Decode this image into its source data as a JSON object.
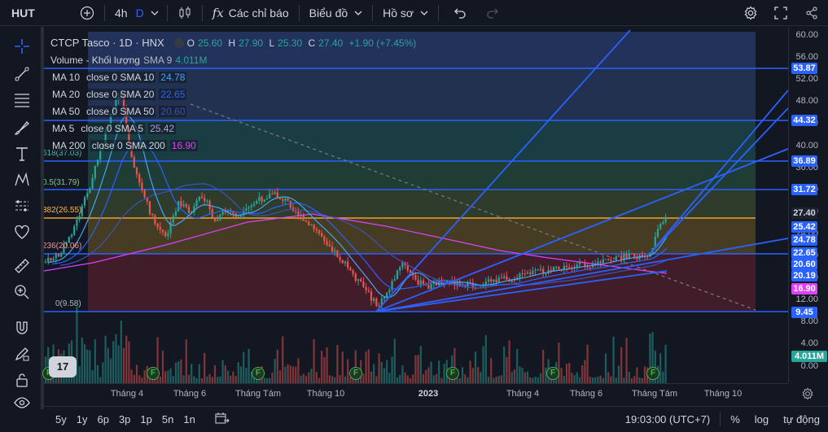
{
  "toolbar": {
    "symbol": "HUT",
    "interval": "4h",
    "interval_alt": "D",
    "indicators_label": "Các chỉ báo",
    "chart_label": "Biểu đồ",
    "profile_label": "Hồ sơ"
  },
  "legend": {
    "title": "CTCP Tasco · 1D · HNX",
    "ohlc": {
      "o_label": "O",
      "o": "25.60",
      "h_label": "H",
      "h": "27.90",
      "l_label": "L",
      "l": "25.30",
      "c_label": "C",
      "c": "27.40",
      "change": "+1.90 (+7.45%)"
    },
    "volume_name": "Volume - Khối lượng",
    "volume_sma": "SMA 9",
    "volume_value": "4.011M",
    "ma": [
      {
        "name": "MA 10",
        "params": "close 0 SMA 10",
        "value": "24.78",
        "color": "#42a5f5"
      },
      {
        "name": "MA 20",
        "params": "close 0 SMA 20",
        "value": "22.65",
        "color": "#2962ff"
      },
      {
        "name": "MA 50",
        "params": "close 0 SMA 50",
        "value": "20.60",
        "color": "#3f51b5"
      },
      {
        "name": "MA 5",
        "params": "close 0 SMA 5",
        "value": "25.42",
        "color": "#b39ddb"
      },
      {
        "name": "MA 200",
        "params": "close 0 SMA 200",
        "value": "16.90",
        "color": "#e040fb"
      }
    ]
  },
  "fib_labels": {
    "l1": "0.5(31.79)",
    "l2": "382(26.55)",
    "l3": "236(20.06)",
    "l4": "0(9.58)",
    "l5": "618(37.03)"
  },
  "price_ticks": [
    "60.00",
    "56.00",
    "52.00",
    "48.00",
    "44.00",
    "40.00",
    "36.00",
    "32.00",
    "28.00",
    "24.00",
    "20.00",
    "16.00",
    "12.00",
    "8.00",
    "4.00",
    "0.00"
  ],
  "price_labels": [
    {
      "value": "53.87",
      "color": "#2962ff"
    },
    {
      "value": "44.32",
      "color": "#2962ff"
    },
    {
      "value": "36.89",
      "color": "#2962ff"
    },
    {
      "value": "31.72",
      "color": "#2962ff"
    },
    {
      "value": "27.40",
      "color": "#1e2230"
    },
    {
      "value": "25.42",
      "color": "#2962ff"
    },
    {
      "value": "24.78",
      "color": "#2962ff"
    },
    {
      "value": "22.65",
      "color": "#2962ff"
    },
    {
      "value": "20.60",
      "color": "#2962ff"
    },
    {
      "value": "20.19",
      "color": "#2962ff"
    },
    {
      "value": "16.90",
      "color": "#e040fb"
    },
    {
      "value": "9.45",
      "color": "#2962ff"
    },
    {
      "value": "4.011M",
      "color": "#26a69a"
    }
  ],
  "time_ticks": [
    {
      "label": "Tháng 4",
      "bold": false
    },
    {
      "label": "Tháng 6",
      "bold": false
    },
    {
      "label": "Tháng Tám",
      "bold": false
    },
    {
      "label": "Tháng 10",
      "bold": false
    },
    {
      "label": "2023",
      "bold": true
    },
    {
      "label": "Tháng 4",
      "bold": false
    },
    {
      "label": "Tháng 6",
      "bold": false
    },
    {
      "label": "Tháng Tám",
      "bold": false
    },
    {
      "label": "Tháng 10",
      "bold": false
    }
  ],
  "bottom": {
    "ranges": [
      "5y",
      "1y",
      "6p",
      "3p",
      "1p",
      "5n",
      "1n"
    ],
    "time": "19:03:00 (UTC+7)",
    "percent": "%",
    "log": "log",
    "auto": "tự động"
  },
  "earnings_badge": "F",
  "logo_text": "17"
}
